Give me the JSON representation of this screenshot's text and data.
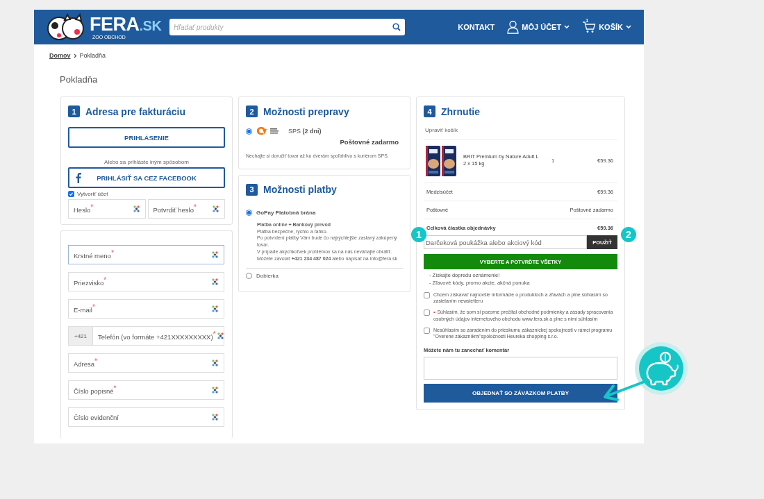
{
  "header": {
    "logo_text": "FERA",
    "logo_suffix": ".SK",
    "logo_tagline": "ZOO OBCHOD",
    "search": {
      "placeholder": "Hľadať produkty"
    },
    "nav": [
      {
        "label": "KONTAKT",
        "kind": "link"
      },
      {
        "label": "MÔJ ÚČET",
        "kind": "account"
      },
      {
        "label": "KOŠÍK",
        "kind": "cart",
        "badge": "1"
      }
    ]
  },
  "breadcrumb": [
    {
      "label": "Domov",
      "kind": "link"
    },
    {
      "label": "Pokladňa",
      "kind": "current"
    }
  ],
  "page_title": "Pokladňa",
  "billing": {
    "number": "1",
    "required_mark": "*",
    "title": "Adresa pre fakturáciu",
    "login_button": "PRIHLÁSENIE",
    "alt_text": "Alebo sa prihláste iným spôsobom",
    "facebook_button": "PRIHLÁSIŤ SA CEZ FACEBOOK",
    "create_account": {
      "label": "Vytvoriť účet",
      "checked": true
    },
    "password_fields": [
      {
        "placeholder": "Heslo",
        "required": true
      },
      {
        "placeholder": "Potvrdiť heslo",
        "required": true
      }
    ],
    "fields": [
      {
        "kind": "text",
        "placeholder": "Krstné meno",
        "required": true,
        "focused": true
      },
      {
        "kind": "text",
        "placeholder": "Priezvisko",
        "required": true,
        "focused": false
      },
      {
        "kind": "text",
        "placeholder": "E-mail",
        "required": true,
        "focused": false
      },
      {
        "kind": "phone",
        "prefix": "+421",
        "placeholder": "Telefón (vo formáte +421XXXXXXXXX)",
        "required": true,
        "focused": false
      },
      {
        "kind": "text",
        "placeholder": "Adresa",
        "required": true,
        "focused": false
      },
      {
        "kind": "text",
        "placeholder": "Číslo popisné",
        "required": true,
        "focused": false
      },
      {
        "kind": "text",
        "placeholder": "Číslo evidenční",
        "required": false,
        "focused": false
      }
    ]
  },
  "shipping": {
    "number": "2",
    "title": "Možnosti prepravy",
    "options": [
      {
        "label": "SPS",
        "detail": "(2 dni)",
        "selected": true,
        "price": "Poštovné zadarmo",
        "note": "Nechajte si doručiť tovar až ku dverám spoľahlivo s kuriérom SPS."
      }
    ]
  },
  "payment": {
    "number": "3",
    "title": "Možnosti platby",
    "options": [
      {
        "label": "GoPay Platobná brána",
        "selected": true,
        "description_title": "Platba online + Bankový prevod",
        "description": [
          "Platba bezpečne, rýchlo a ľahko.",
          "Po potvrdení platby Vám bude čo najrýchlejšie zaslaný zakúpený tovar.",
          "V prípade akýchkoľvek problémov sa na nás neváhajte obrátiť. Môžete zavolať **+421 234 487 024** alebo napísať na info@fera.sk"
        ]
      },
      {
        "label": "Dobierka",
        "selected": false
      }
    ]
  },
  "summary": {
    "number": "4",
    "title": "Zhrnutie",
    "edit_link": "Upraviť košík",
    "items": [
      {
        "name": "BRIT Premium by Nature Adult L",
        "variant": "2 x 15 kg",
        "quantity": "1",
        "price": "€59.36"
      }
    ],
    "rows": [
      {
        "kind": "line",
        "label": "Medzisúčet",
        "value": "€59.36"
      },
      {
        "kind": "line",
        "label": "Poštovné",
        "value": "Poštovné zadarmo"
      },
      {
        "kind": "total",
        "label": "Celková čiastka objednávky",
        "value": "€59.36"
      }
    ],
    "coupon": {
      "placeholder": "Darčeková poukážka alebo akciový kód",
      "button": "POUŽIŤ"
    },
    "consent_required_mark": "•",
    "select_all_button": "VYBERTE A POTVRĎTE VŠETKY",
    "benefits": [
      "- Získajte dopredu oznámenie!",
      "- Zľavové kódy, promo akcie, akčná ponuka"
    ],
    "consents": [
      {
        "text": "Chcem získavať najnovšie informácie o produktoch a zľavách a plne súhlasím so zasielaním newsletteru",
        "checked": false,
        "required": false
      },
      {
        "text": "Súhlasím, že som si pozorne prečítal obchodné podmienky a zásady spracovania osobných údajov internetového obchodu www.fera.sk a plne s nimi súhlasím",
        "checked": false,
        "required": true
      },
      {
        "text": "Nesúhlasím so zaradením do prieskumu zákazníckej spokojnosti v rámci programu \"Overené zákazníkmi\"spoločnosti Heureka shopping s.r.o.",
        "checked": false,
        "required": false
      }
    ],
    "comment_label": "Môžete nám tu zanechať komentár",
    "order_button": "OBJEDNAŤ SO ZÁVÄZKOM PLATBY"
  },
  "callouts": [
    {
      "number": "1"
    },
    {
      "number": "2"
    }
  ]
}
